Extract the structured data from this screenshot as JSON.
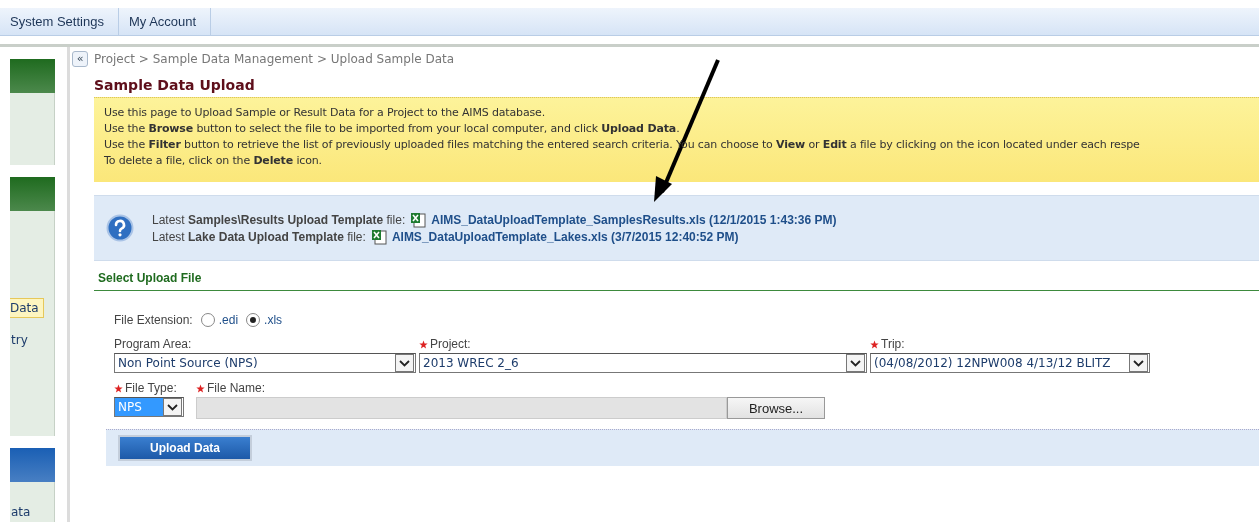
{
  "nav_tabs": [
    {
      "label": "System Settings"
    },
    {
      "label": "My Account"
    }
  ],
  "sidebar": {
    "sections": [
      {
        "color": "#1f6b1f"
      },
      {
        "color": "#1f6b1f",
        "items": [
          {
            "label": "Data",
            "selected": true
          },
          {
            "label": "try",
            "selected": false
          }
        ]
      },
      {
        "color": "#1a5fb4",
        "items": [
          {
            "label": "ata",
            "selected": false
          }
        ]
      }
    ]
  },
  "collapse_button": "«",
  "breadcrumb": "Project > Sample Data Management > Upload Sample Data",
  "title": "Sample Data Upload",
  "instructions": [
    "Use this page to Upload Sample or Result Data for a Project to the AIMS database.",
    "Use the **Browse** button to select the file to be imported from your local computer, and click **Upload Data**.",
    "Use the **Filter** button to retrieve the list of previously uploaded files matching the entered search criteria. You can choose to **View** or **Edit** a file by clicking on the icon located under each respe",
    "To delete a file, click on the **Delete** icon."
  ],
  "templates": [
    {
      "label": "Latest **Samples\\Results Upload Template** file:",
      "link": "AIMS_DataUploadTemplate_SamplesResults.xls (12/1/2015 1:43:36 PM)"
    },
    {
      "label": "Latest **Lake Data Upload Template** file:",
      "link": "AIMS_DataUploadTemplate_Lakes.xls (3/7/2015 12:40:52 PM)"
    }
  ],
  "section_title": "Select Upload File",
  "file_extension": {
    "label": "File Extension:",
    "options": [
      {
        "label": ".edi",
        "selected": false
      },
      {
        "label": ".xls",
        "selected": true
      }
    ]
  },
  "selects": [
    {
      "label": "Program Area:",
      "required": false,
      "value": "Non Point Source (NPS)"
    },
    {
      "label": "Project:",
      "required": true,
      "value": "2013 WREC 2_6"
    },
    {
      "label": "Trip:",
      "required": true,
      "value": "(04/08/2012) 12NPW008 4/13/12 BLITZ"
    }
  ],
  "file_type": {
    "label": "File Type:",
    "required": true,
    "value": "NPS",
    "highlighted": true
  },
  "file_name": {
    "label": "File Name:",
    "required": true,
    "browse": "Browse..."
  },
  "upload_button": "Upload Data"
}
